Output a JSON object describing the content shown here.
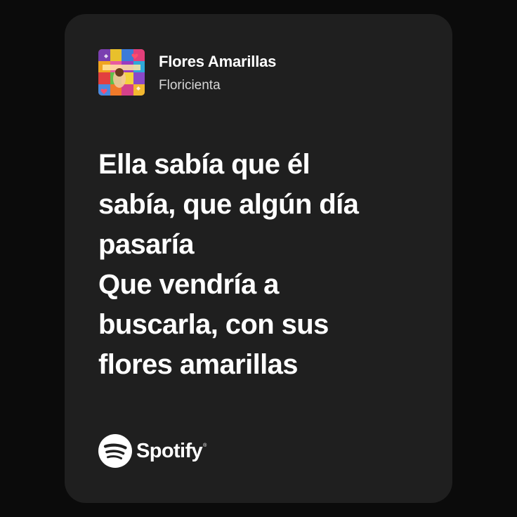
{
  "track": {
    "title": "Flores Amarillas",
    "artist": "Floricienta"
  },
  "lyrics": {
    "lines": [
      "Ella sabía que él",
      "sabía, que algún día",
      "pasaría",
      "Que vendría a",
      "buscarla, con sus",
      "flores amarillas"
    ]
  },
  "brand": {
    "name": "Spotify",
    "icon": "spotify-logo-icon",
    "registered_mark": "®"
  },
  "colors": {
    "page_background": "#0b0b0b",
    "card_background": "#1f1f1f",
    "text_primary": "#ffffff",
    "text_secondary": "#d6d6d6"
  }
}
